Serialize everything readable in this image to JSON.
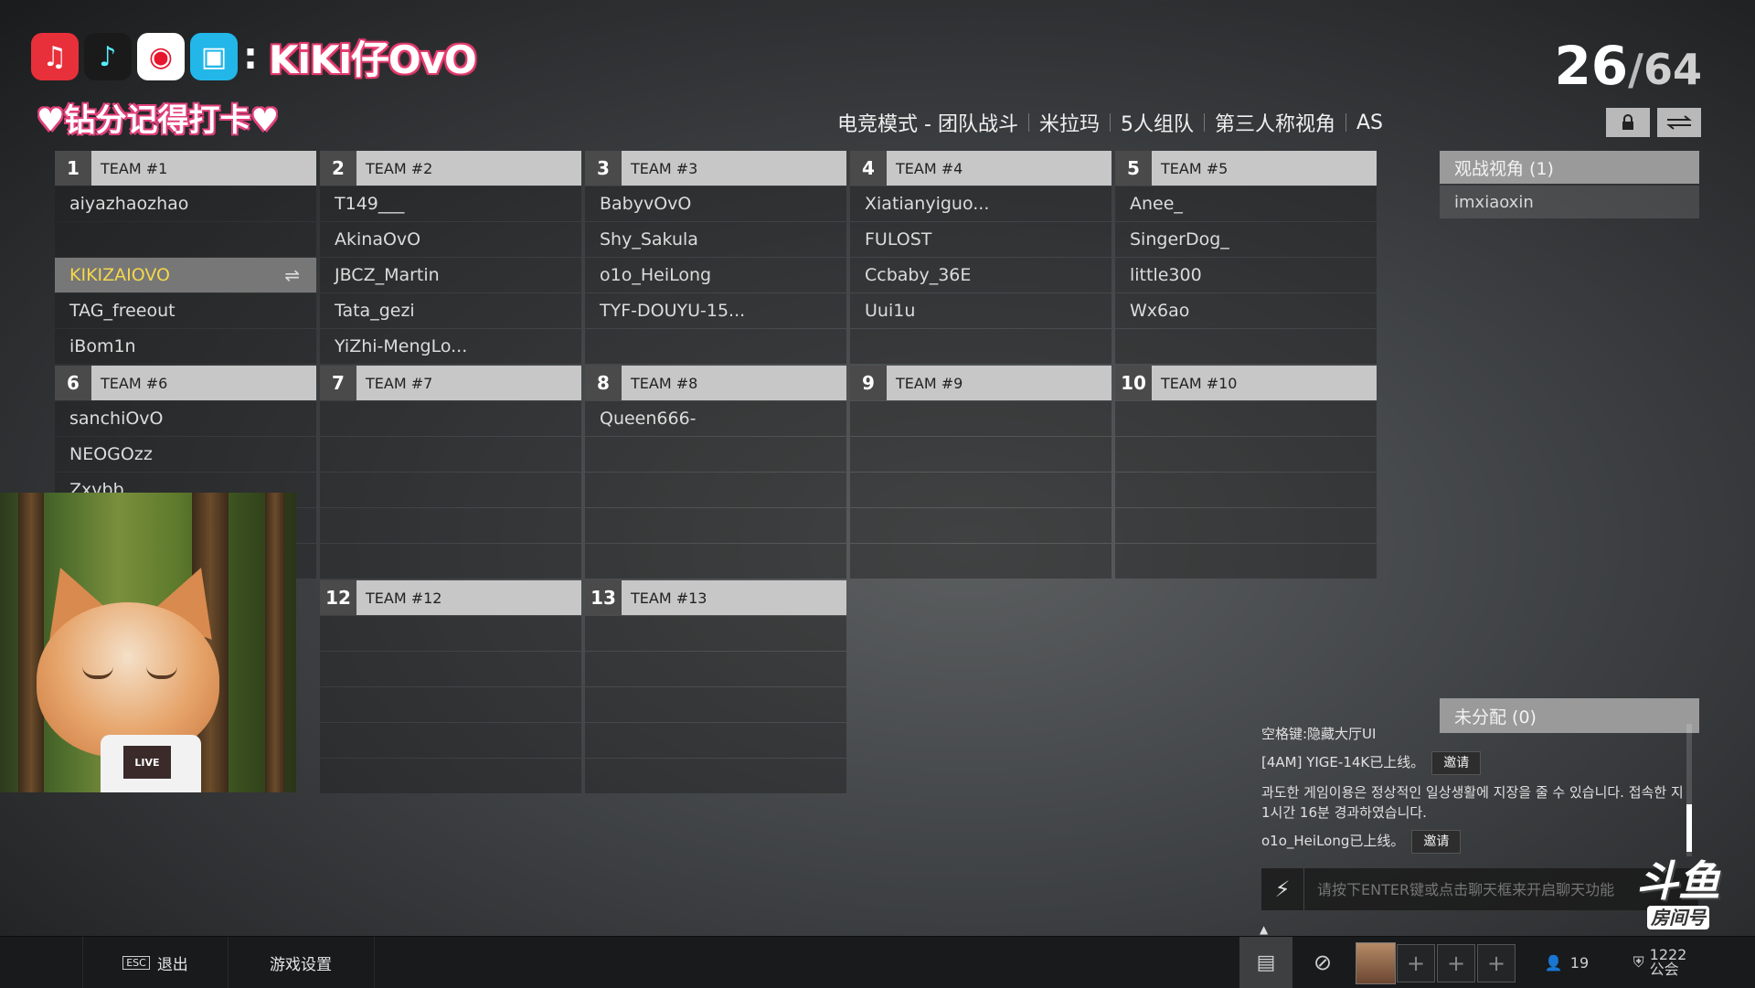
{
  "overlay": {
    "socials": [
      {
        "icon": "netease-music-icon",
        "color": "#e8303a",
        "glyph": "♫"
      },
      {
        "icon": "douyin-icon",
        "color": "#1a1a1a",
        "glyph": "♪"
      },
      {
        "icon": "weibo-icon",
        "color": "#ffffff",
        "glyph": "◉"
      },
      {
        "icon": "bilibili-icon",
        "color": "#22b7e8",
        "glyph": "▣"
      }
    ],
    "colon": ":",
    "streamer_name": "KiKi仔OvO",
    "tagline": "♥钻分记得打卡♥"
  },
  "counter": {
    "current": "26",
    "separator": "/",
    "max": "64"
  },
  "mode_bar": [
    "电竞模式 - 团队战斗",
    "米拉玛",
    "5人组队",
    "第三人称视角",
    "AS"
  ],
  "icons": {
    "lock": "lock-icon",
    "swap": "swap-icon"
  },
  "teams": [
    {
      "num": "1",
      "name": "TEAM #1",
      "slots": [
        "aiyazhaozhao",
        "",
        "KIKIZAIOVO",
        "TAG_freeout",
        "iBom1n"
      ]
    },
    {
      "num": "2",
      "name": "TEAM #2",
      "slots": [
        "T149___",
        "AkinaOvO",
        "JBCZ_Martin",
        "Tata_gezi",
        "YiZhi-MengLo..."
      ]
    },
    {
      "num": "3",
      "name": "TEAM #3",
      "slots": [
        "BabyvOvO",
        "Shy_Sakula",
        "o1o_HeiLong",
        "TYF-DOUYU-15...",
        ""
      ]
    },
    {
      "num": "4",
      "name": "TEAM #4",
      "slots": [
        "Xiatianyiguo...",
        "FULOST",
        "Ccbaby_36E",
        "Uui1u",
        ""
      ]
    },
    {
      "num": "5",
      "name": "TEAM #5",
      "slots": [
        "Anee_",
        "SingerDog_",
        "little300",
        "Wx6ao",
        ""
      ]
    },
    {
      "num": "6",
      "name": "TEAM #6",
      "slots": [
        "sanchiOvO",
        "NEOGOzz",
        "Zxvbb",
        "",
        ""
      ]
    },
    {
      "num": "7",
      "name": "TEAM #7",
      "slots": [
        "",
        "",
        "",
        "",
        ""
      ]
    },
    {
      "num": "8",
      "name": "TEAM #8",
      "slots": [
        "Queen666-",
        "",
        "",
        "",
        ""
      ]
    },
    {
      "num": "9",
      "name": "TEAM #9",
      "slots": [
        "",
        "",
        "",
        "",
        ""
      ]
    },
    {
      "num": "10",
      "name": "TEAM #10",
      "slots": [
        "",
        "",
        "",
        "",
        ""
      ]
    },
    {
      "num": "12",
      "name": "TEAM #12",
      "slots": [
        "",
        "",
        "",
        "",
        ""
      ]
    },
    {
      "num": "13",
      "name": "TEAM #13",
      "slots": [
        "",
        "",
        "",
        "",
        ""
      ]
    }
  ],
  "active_player": "KIKIZAIOVO",
  "spectator": {
    "header": "观战视角 (1)",
    "players": [
      "imxiaoxin"
    ]
  },
  "unassigned": {
    "header": "未分配 (0)"
  },
  "chat": {
    "hint": "空格键:隐藏大厅UI",
    "line1": "[4AM] YIGE-14K已上线。",
    "line2": "과도한 게임이용은 정상적인 일상생활에 지장을 줄 수 있습니다. 접속한 지 1시간 16분 경과하였습니다.",
    "line3": "o1o_HeiLong已上线。",
    "invite": "邀请",
    "input_placeholder": "请按下ENTER键或点击聊天框来开启聊天功能"
  },
  "douyu": {
    "big": "斗鱼",
    "small": "房间号"
  },
  "bottom_bar": {
    "esc_key": "ESC",
    "exit": "退出",
    "settings": "游戏设置",
    "friends_count": "19",
    "guild_count": "1222",
    "guild_label": "公会"
  }
}
